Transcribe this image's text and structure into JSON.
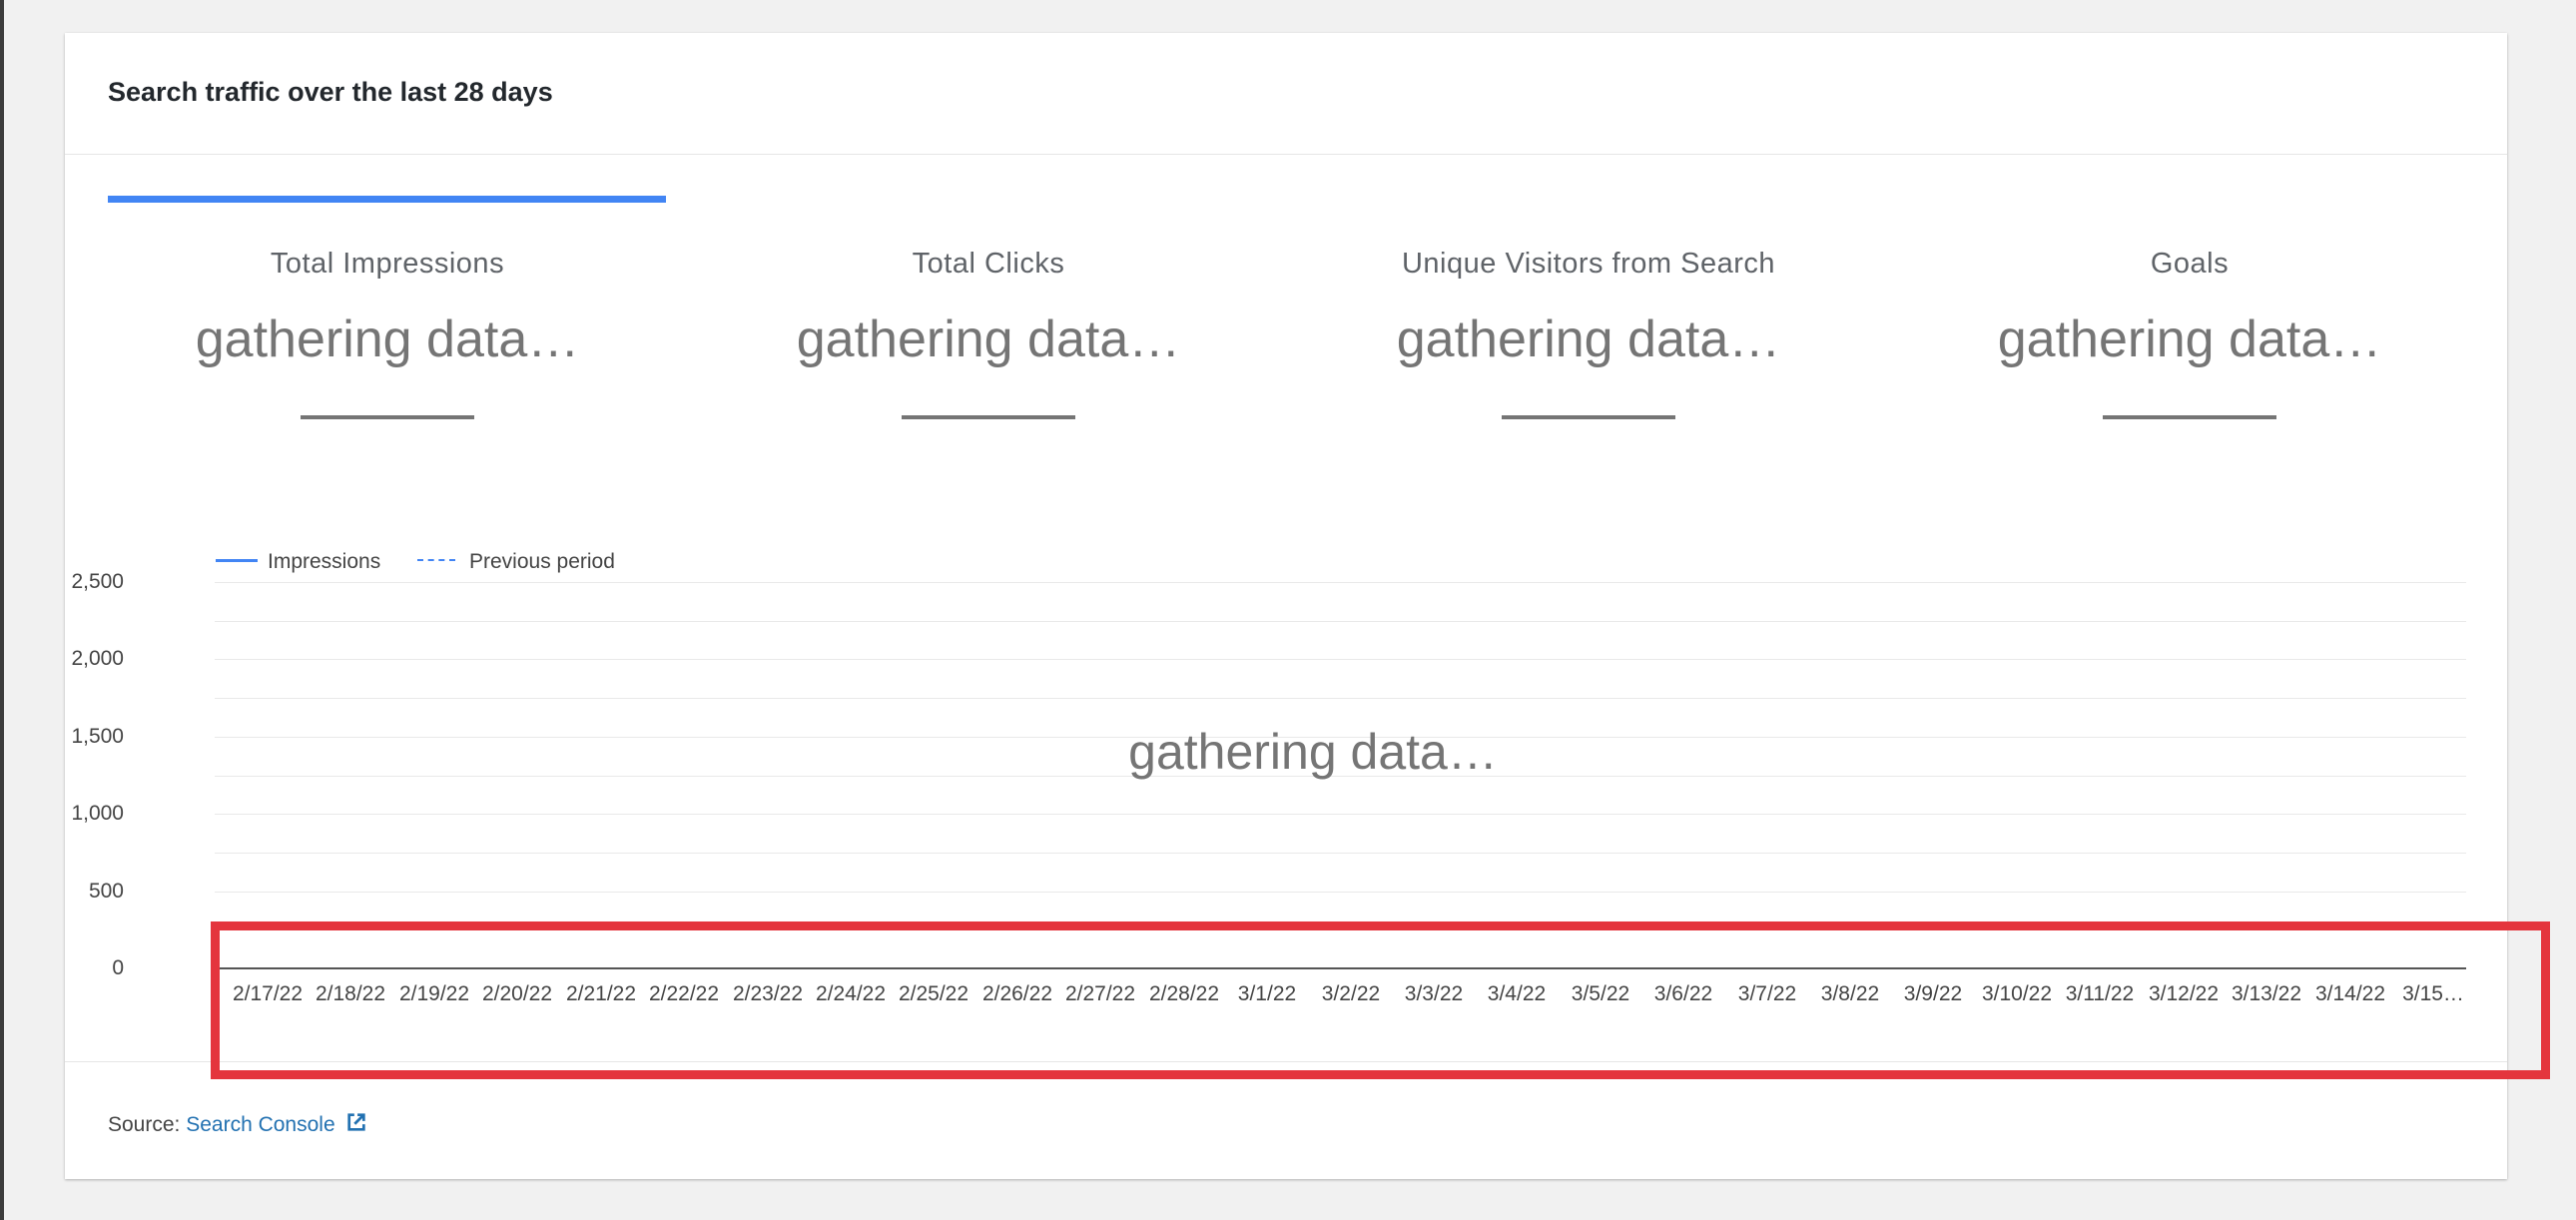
{
  "card": {
    "title": "Search traffic over the last 28 days"
  },
  "stats": [
    {
      "title": "Total Impressions",
      "value": "gathering data…"
    },
    {
      "title": "Total Clicks",
      "value": "gathering data…"
    },
    {
      "title": "Unique Visitors from Search",
      "value": "gathering data…"
    },
    {
      "title": "Goals",
      "value": "gathering data…"
    }
  ],
  "chart": {
    "overlay_text": "gathering data…"
  },
  "chart_data": {
    "type": "line",
    "title": "",
    "xlabel": "",
    "ylabel": "",
    "legend": {
      "placement": "top-left",
      "entries": [
        "Impressions",
        "Previous period"
      ]
    },
    "y_ticks": [
      "2,500",
      "2,000",
      "1,500",
      "1,000",
      "500",
      "0"
    ],
    "ylim": [
      0,
      2500
    ],
    "grid": true,
    "x": [
      "2/17/22",
      "2/18/22",
      "2/19/22",
      "2/20/22",
      "2/21/22",
      "2/22/22",
      "2/23/22",
      "2/24/22",
      "2/25/22",
      "2/26/22",
      "2/27/22",
      "2/28/22",
      "3/1/22",
      "3/2/22",
      "3/3/22",
      "3/4/22",
      "3/5/22",
      "3/6/22",
      "3/7/22",
      "3/8/22",
      "3/9/22",
      "3/10/22",
      "3/11/22",
      "3/12/22",
      "3/13/22",
      "3/14/22",
      "3/15…"
    ],
    "series": [
      {
        "name": "Impressions",
        "values": [],
        "style": "solid",
        "color": "#4285f4"
      },
      {
        "name": "Previous period",
        "values": [],
        "style": "dashed",
        "color": "#4285f4"
      }
    ]
  },
  "footer": {
    "source_label": "Source:",
    "source_link": "Search Console",
    "link_icon": "external-link-icon"
  },
  "colors": {
    "accent": "#4285f4",
    "link": "#2271b1",
    "highlight": "#e4353d"
  }
}
